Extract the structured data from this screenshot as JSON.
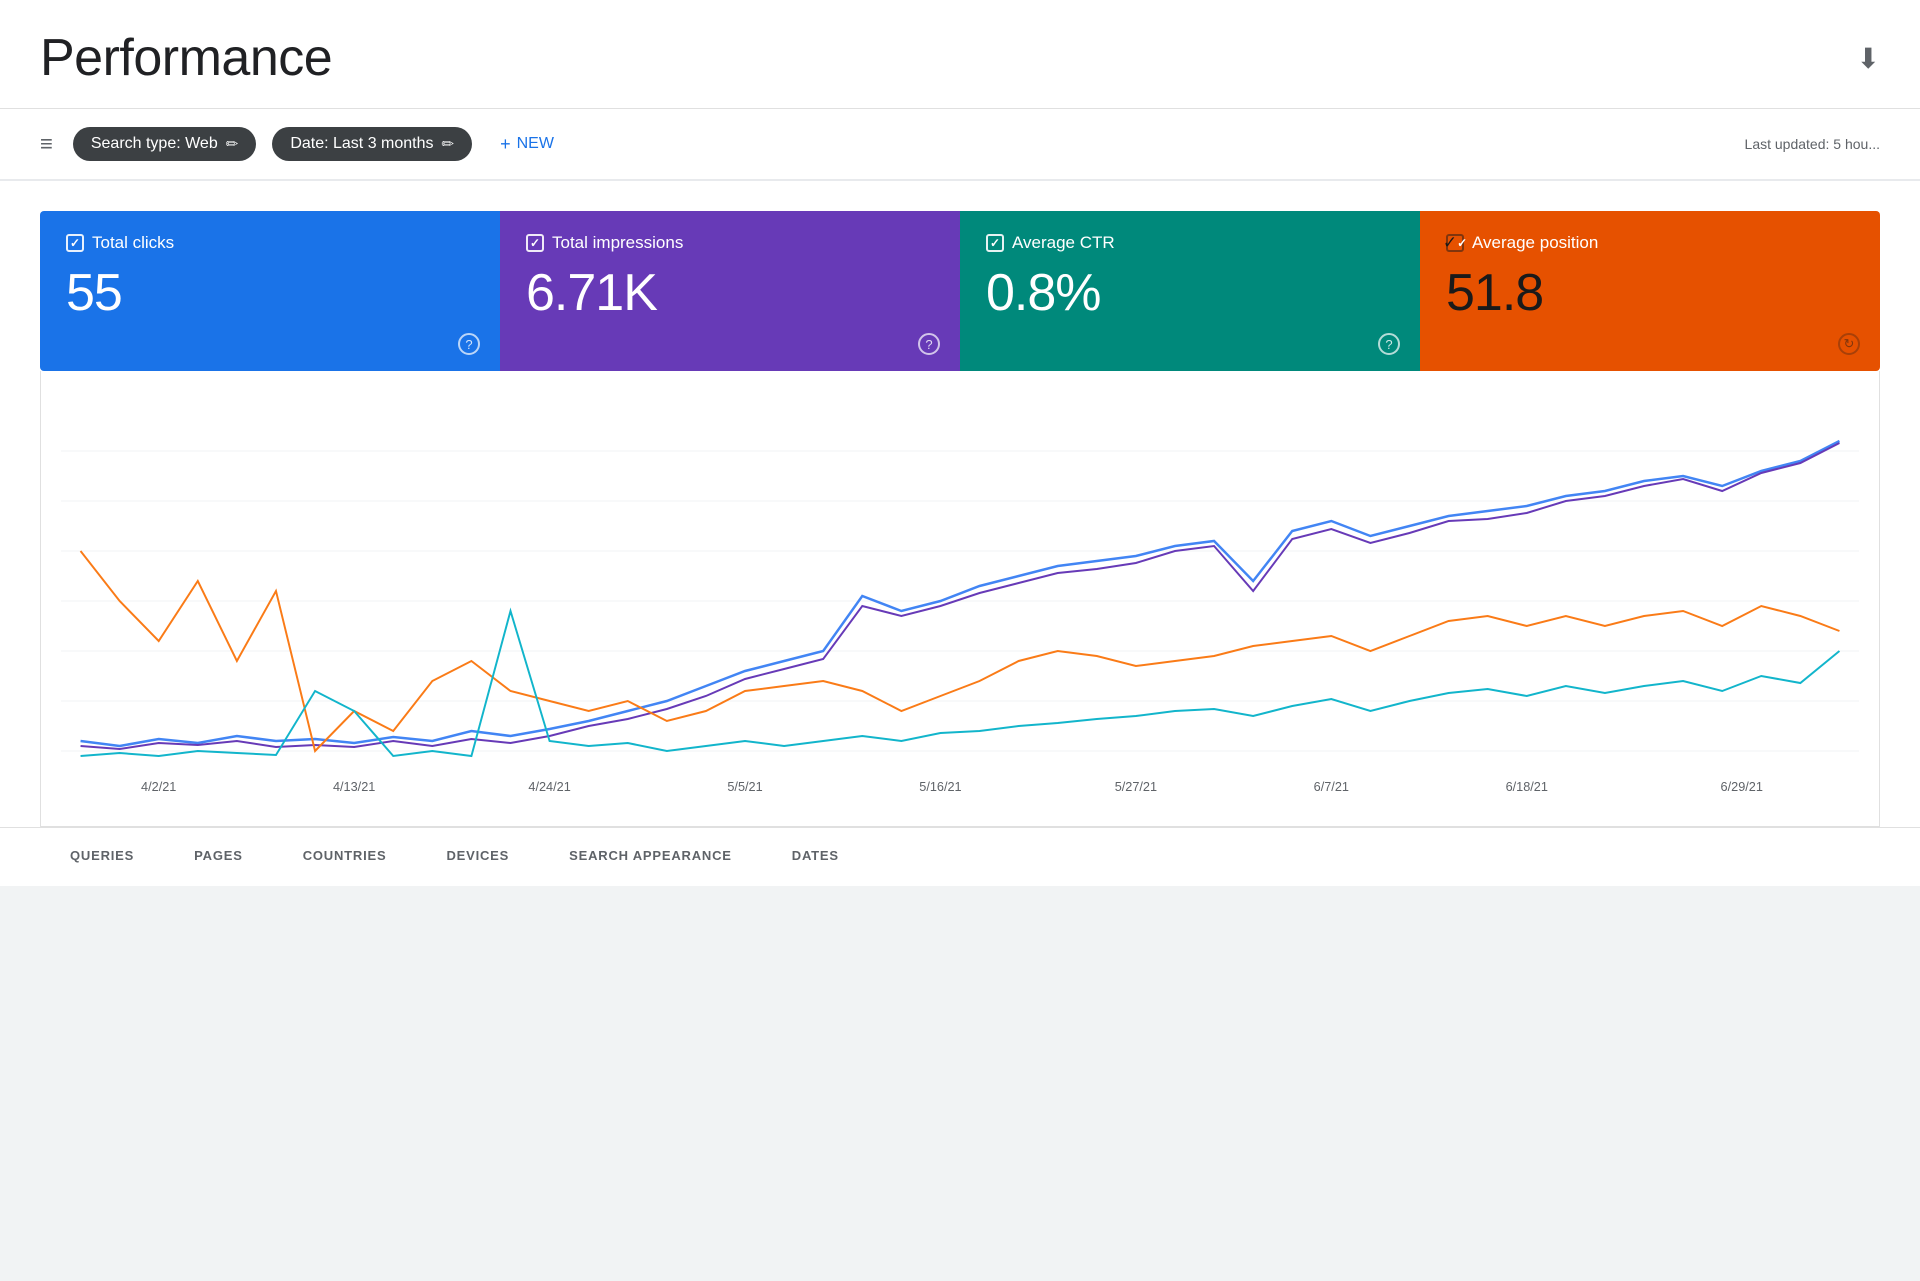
{
  "page": {
    "title": "Performance",
    "last_updated": "Last updated: 5 hou..."
  },
  "toolbar": {
    "filter_icon": "≡",
    "search_type_label": "Search type: Web",
    "date_label": "Date: Last 3 months",
    "new_label": "NEW",
    "edit_icon": "✏"
  },
  "metrics": [
    {
      "id": "clicks",
      "label": "Total clicks",
      "value": "55",
      "color": "#1a73e8",
      "text_color": "#fff"
    },
    {
      "id": "impressions",
      "label": "Total impressions",
      "value": "6.71K",
      "color": "#673ab7",
      "text_color": "#fff"
    },
    {
      "id": "ctr",
      "label": "Average CTR",
      "value": "0.8%",
      "color": "#00897b",
      "text_color": "#fff"
    },
    {
      "id": "position",
      "label": "Average position",
      "value": "51.8",
      "color": "#e65100",
      "text_color": "#1a1a1a"
    }
  ],
  "chart": {
    "x_labels": [
      "4/2/21",
      "4/13/21",
      "4/24/21",
      "5/5/21",
      "5/16/21",
      "5/27/21",
      "6/7/21",
      "6/18/21",
      "6/29/21"
    ]
  },
  "bottom_tabs": [
    {
      "id": "queries",
      "label": "QUERIES"
    },
    {
      "id": "pages",
      "label": "PAGES"
    },
    {
      "id": "countries",
      "label": "COUNTRIES"
    },
    {
      "id": "devices",
      "label": "DEVICES"
    },
    {
      "id": "search-appearance",
      "label": "SEARCH APPEARANCE"
    },
    {
      "id": "dates",
      "label": "DATES"
    }
  ]
}
